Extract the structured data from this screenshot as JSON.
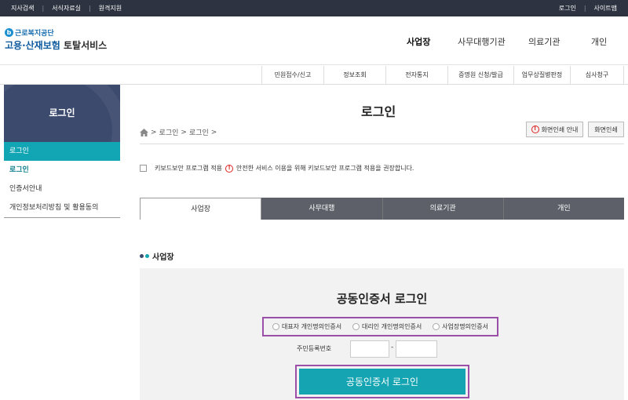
{
  "topbar": {
    "left": [
      "지사검색",
      "서식자료실",
      "원격지원"
    ],
    "right": [
      "로그인",
      "사이트맵"
    ]
  },
  "logo": {
    "org": "근로복지공단",
    "service_blue": "고용·산재보험",
    "service_dark": "토탈서비스"
  },
  "main_nav": [
    "사업장",
    "사무대행기관",
    "의료기관",
    "개인"
  ],
  "sub_nav": [
    "민원접수/신고",
    "정보조회",
    "전자통지",
    "증명원 신청/발급",
    "업무상질병판정",
    "심사청구"
  ],
  "sidebar": {
    "title": "로그인",
    "selected": "로그인",
    "items": [
      "로그인",
      "인증서안내",
      "개인정보처리방침 및 활용동의"
    ]
  },
  "page": {
    "title": "로그인",
    "breadcrumb": [
      "로그인",
      "로그인"
    ],
    "print_guide": "화면인쇄 안내",
    "print": "화면인쇄"
  },
  "keyboard": {
    "label": "키보드보안 프로그램 적용",
    "notice": "안전한 서비스 이용을 위해 키보드보안 프로그램 적용을 권장합니다."
  },
  "tabs": [
    "사업장",
    "사무대행",
    "의료기관",
    "개인"
  ],
  "section_title": "사업장",
  "panel": {
    "title": "공동인증서 로그인",
    "radios": [
      "대표자 개인명의인증서",
      "대리인 개인명의인증서",
      "사업장명의인증서"
    ],
    "ssn_label": "주민등록번호",
    "ssn_dash": "-",
    "login_button": "공동인증서 로그인"
  },
  "colors": {
    "accent": "#14a4b2",
    "highlight": "#9b4fa8",
    "sidebar_head": "#3c4a6e"
  }
}
